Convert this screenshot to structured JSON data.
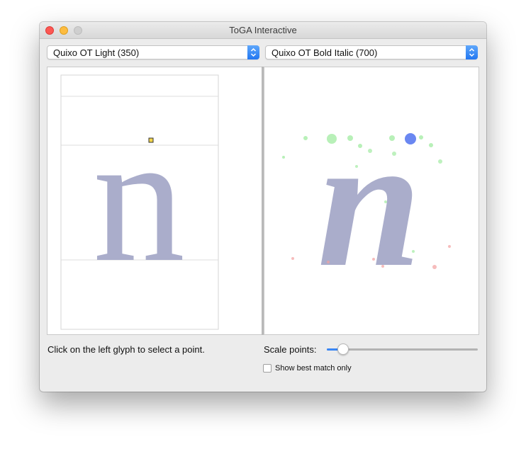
{
  "window": {
    "title": "ToGA Interactive"
  },
  "fonts": {
    "left_select": "Quixo OT Light (350)",
    "right_select": "Quixo OT Bold Italic (700)"
  },
  "glyph": {
    "character": "n",
    "fill_color": "#aaadcb"
  },
  "status_text": "Click on the left glyph to select a point.",
  "scale": {
    "label": "Scale points:",
    "value": 0.11
  },
  "best_match": {
    "label": "Show best match only",
    "checked": false
  },
  "colors": {
    "accent": "#2f7ef5",
    "selected_point": "#f3d54a",
    "match_best": "#5a7af0",
    "match_good": "#7ee37e",
    "match_poor": "#f2a0a0"
  }
}
